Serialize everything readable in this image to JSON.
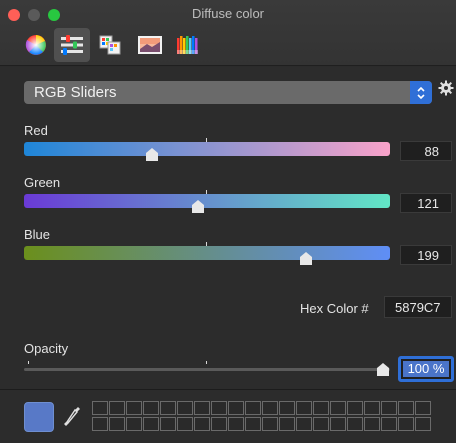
{
  "window": {
    "title": "Diffuse color"
  },
  "toolbar": {
    "tools": [
      {
        "name": "color-wheel",
        "selected": false
      },
      {
        "name": "color-sliders",
        "selected": true
      },
      {
        "name": "color-palettes",
        "selected": false
      },
      {
        "name": "image-palettes",
        "selected": false
      },
      {
        "name": "pencils",
        "selected": false
      }
    ]
  },
  "mode_select": {
    "selected": "RGB Sliders"
  },
  "sliders": {
    "red": {
      "label": "Red",
      "value": "88",
      "fraction": 0.345,
      "gradient": [
        "#1e86d8",
        "#f9a2c9"
      ]
    },
    "green": {
      "label": "Green",
      "value": "121",
      "fraction": 0.475,
      "gradient": [
        "#6a3ad6",
        "#62e6c6"
      ]
    },
    "blue": {
      "label": "Blue",
      "value": "199",
      "fraction": 0.78,
      "gradient": [
        "#6b8f1c",
        "#5f8ef6"
      ]
    }
  },
  "hex": {
    "label": "Hex Color #",
    "value": "5879C7"
  },
  "opacity": {
    "label": "Opacity",
    "value": "100 %",
    "fraction": 1.0
  },
  "current_color": "#5879C7",
  "colors": {
    "accent": "#2f6fd7",
    "background": "#2c2c2c"
  }
}
